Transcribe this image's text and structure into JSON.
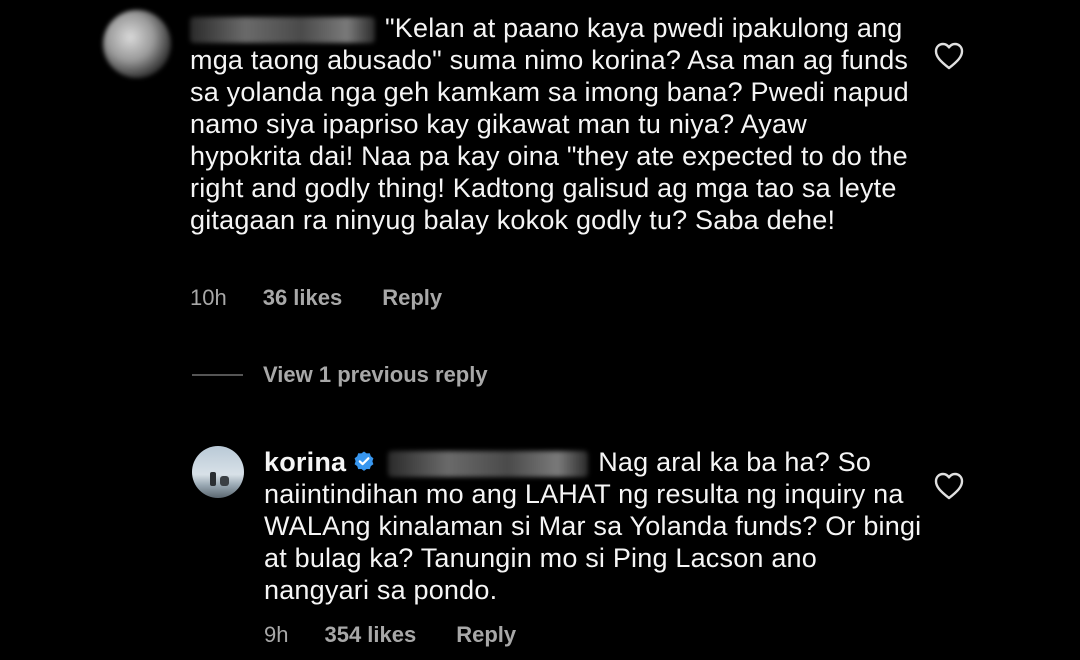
{
  "comments": [
    {
      "text": "\"Kelan at paano kaya pwedi ipakulong ang mga taong abusado\" suma nimo korina? Asa man ag funds sa yolanda nga geh kamkam sa imong bana? Pwedi napud namo siya ipapriso kay gikawat man tu niya? Ayaw hypokrita dai! Naa pa kay oina \"they ate expected to do the right and godly thing! Kadtong galisud ag mga tao sa leyte gitagaan ra ninyug balay kokok godly tu? Saba dehe!",
      "time": "10h",
      "likes": "36 likes",
      "reply": "Reply"
    }
  ],
  "view_replies": {
    "label": "View 1 previous reply"
  },
  "reply": {
    "username": "korina",
    "text": "Nag aral ka ba ha? So naiintindihan mo ang LAHAT ng resulta ng inquiry na WALAng kinalaman si Mar sa Yolanda funds? Or bingi at bulag ka? Tanungin mo si Ping Lacson ano nangyari sa pondo.",
    "time": "9h",
    "likes": "354 likes",
    "reply": "Reply"
  },
  "colors": {
    "background": "#000000",
    "text": "#f5f5f5",
    "meta": "#a8a8a8",
    "verified": "#3897f0"
  },
  "icons": {
    "like": "heart-outline-icon",
    "verified": "verified-badge-icon"
  }
}
